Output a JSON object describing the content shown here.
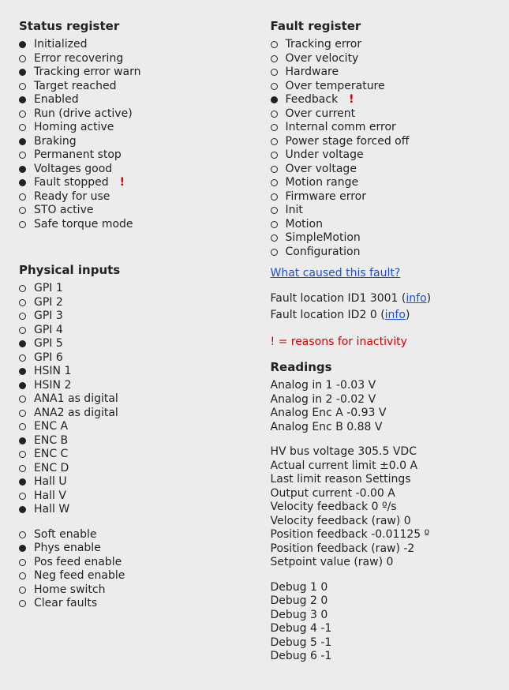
{
  "status": {
    "title": "Status register",
    "items": [
      {
        "label": "Initialized",
        "on": true
      },
      {
        "label": "Error recovering",
        "on": false
      },
      {
        "label": "Tracking error warn",
        "on": true
      },
      {
        "label": "Target reached",
        "on": false
      },
      {
        "label": "Enabled",
        "on": true
      },
      {
        "label": "Run (drive active)",
        "on": false
      },
      {
        "label": "Homing active",
        "on": false
      },
      {
        "label": "Braking",
        "on": true
      },
      {
        "label": "Permanent stop",
        "on": false
      },
      {
        "label": "Voltages good",
        "on": true
      },
      {
        "label": "Fault stopped",
        "on": true,
        "flag": true
      },
      {
        "label": "Ready for use",
        "on": false
      },
      {
        "label": "STO active",
        "on": false
      },
      {
        "label": "Safe torque mode",
        "on": false
      }
    ]
  },
  "physical": {
    "title": "Physical inputs",
    "group1": [
      {
        "label": "GPI 1",
        "on": false
      },
      {
        "label": "GPI 2",
        "on": false
      },
      {
        "label": "GPI 3",
        "on": false
      },
      {
        "label": "GPI 4",
        "on": false
      },
      {
        "label": "GPI 5",
        "on": true
      },
      {
        "label": "GPI 6",
        "on": false
      },
      {
        "label": "HSIN 1",
        "on": true
      },
      {
        "label": "HSIN 2",
        "on": true
      },
      {
        "label": "ANA1 as digital",
        "on": false
      },
      {
        "label": "ANA2 as digital",
        "on": false
      },
      {
        "label": "ENC A",
        "on": false
      },
      {
        "label": "ENC B",
        "on": true
      },
      {
        "label": "ENC C",
        "on": false
      },
      {
        "label": "ENC D",
        "on": false
      },
      {
        "label": "Hall U",
        "on": true
      },
      {
        "label": "Hall V",
        "on": false
      },
      {
        "label": "Hall W",
        "on": true
      }
    ],
    "group2": [
      {
        "label": "Soft enable",
        "on": false
      },
      {
        "label": "Phys enable",
        "on": true
      },
      {
        "label": "Pos feed enable",
        "on": false
      },
      {
        "label": "Neg feed enable",
        "on": false
      },
      {
        "label": "Home switch",
        "on": false
      },
      {
        "label": "Clear faults",
        "on": false
      }
    ]
  },
  "fault": {
    "title": "Fault register",
    "link_text": "What caused this fault?",
    "loc1_prefix": "Fault location ID1 ",
    "loc1_value": "3001",
    "loc2_prefix": "Fault location ID2 ",
    "loc2_value": "0",
    "info_label": "info",
    "inactivity_note": "! = reasons for inactivity",
    "items": [
      {
        "label": "Tracking error",
        "on": false
      },
      {
        "label": "Over velocity",
        "on": false
      },
      {
        "label": "Hardware",
        "on": false
      },
      {
        "label": "Over temperature",
        "on": false
      },
      {
        "label": "Feedback",
        "on": true,
        "flag": true
      },
      {
        "label": "Over current",
        "on": false
      },
      {
        "label": "Internal comm error",
        "on": false
      },
      {
        "label": "Power stage forced off",
        "on": false
      },
      {
        "label": "Under voltage",
        "on": false
      },
      {
        "label": "Over voltage",
        "on": false
      },
      {
        "label": "Motion range",
        "on": false
      },
      {
        "label": "Firmware error",
        "on": false
      },
      {
        "label": "Init",
        "on": false
      },
      {
        "label": "Motion",
        "on": false
      },
      {
        "label": "SimpleMotion",
        "on": false
      },
      {
        "label": "Configuration",
        "on": false
      }
    ]
  },
  "readings": {
    "title": "Readings",
    "group1": [
      {
        "label": "Analog in 1",
        "value": "-0.03 V"
      },
      {
        "label": "Analog in 2",
        "value": "-0.02 V"
      },
      {
        "label": "Analog Enc A",
        "value": "-0.93 V"
      },
      {
        "label": "Analog Enc B",
        "value": "0.88 V"
      }
    ],
    "group2": [
      {
        "label": "HV bus voltage",
        "value": "305.5 VDC"
      },
      {
        "label": "Actual current limit",
        "value": "±0.0 A"
      },
      {
        "label": "Last limit reason",
        "value": "Settings"
      },
      {
        "label": "Output current",
        "value": "-0.00 A"
      },
      {
        "label": "Velocity feedback",
        "value": "0 º/s"
      },
      {
        "label": "Velocity feedback (raw)",
        "value": "0"
      },
      {
        "label": "Position feedback",
        "value": "-0.01125 º"
      },
      {
        "label": "Position feedback (raw)",
        "value": "-2"
      },
      {
        "label": "Setpoint value (raw)",
        "value": "0"
      }
    ],
    "group3": [
      {
        "label": "Debug 1",
        "value": "0"
      },
      {
        "label": "Debug 2",
        "value": "0"
      },
      {
        "label": "Debug 3",
        "value": "0"
      },
      {
        "label": "Debug 4",
        "value": "-1"
      },
      {
        "label": "Debug 5",
        "value": "-1"
      },
      {
        "label": "Debug 6",
        "value": "-1"
      }
    ]
  }
}
